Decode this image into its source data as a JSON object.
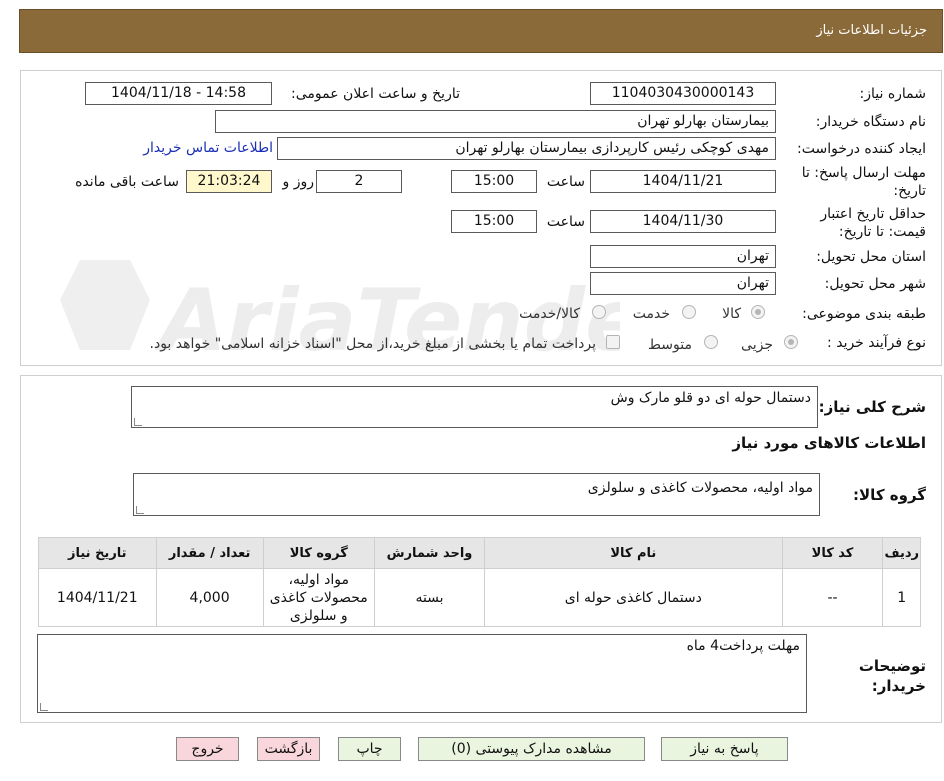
{
  "header": {
    "title": "جزئیات اطلاعات نیاز"
  },
  "form": {
    "need_number_label": "شماره نیاز:",
    "need_number": "1104030430000143",
    "announce_label": "تاریخ و ساعت اعلان عمومی:",
    "announce_value": "1404/11/18 - 14:58",
    "buyer_org_label": "نام دستگاه خریدار:",
    "buyer_org": "بیمارستان بهارلو تهران",
    "requester_label": "ایجاد کننده درخواست:",
    "requester": "مهدی کوچکی  رئیس کارپردازی بیمارستان بهارلو تهران",
    "contact_link": "اطلاعات تماس خریدار",
    "reply_deadline_label": "مهلت ارسال پاسخ: تا تاریخ:",
    "reply_date": "1404/11/21",
    "time_label": "ساعت",
    "reply_time": "15:00",
    "days_value": "2",
    "days_label": "روز و",
    "remaining_time": "21:03:24",
    "remaining_label": "ساعت باقی مانده",
    "validity_label": "حداقل تاریخ اعتبار قیمت: تا تاریخ:",
    "validity_date": "1404/11/30",
    "validity_time": "15:00",
    "province_label": "استان محل تحویل:",
    "province": "تهران",
    "city_label": "شهر محل تحویل:",
    "city": "تهران",
    "category_label": "طبقه بندی موضوعی:",
    "category_options": [
      "کالا",
      "خدمت",
      "کالا/خدمت"
    ],
    "process_label": "نوع فرآیند خرید :",
    "process_options": [
      "جزیی",
      "متوسط"
    ],
    "payment_note": "پرداخت تمام یا بخشی از مبلغ خرید،از محل \"اسناد خزانه اسلامی\" خواهد بود."
  },
  "details": {
    "summary_label": "شرح کلی نیاز:",
    "summary": "دستمال حوله ای دو قلو مارک وش",
    "goods_info_title": "اطلاعات کالاهای مورد نیاز",
    "goods_group_label": "گروه کالا:",
    "goods_group": "مواد اولیه، محصولات کاغذی و سلولزی",
    "table": {
      "headers": [
        "ردیف",
        "کد کالا",
        "نام کالا",
        "واحد شمارش",
        "گروه کالا",
        "تعداد / مقدار",
        "تاریخ نیاز"
      ],
      "rows": [
        [
          "1",
          "--",
          "دستمال کاغذی حوله ای",
          "بسته",
          "مواد اولیه، محصولات کاغذی و سلولزی",
          "4,000",
          "1404/11/21"
        ]
      ]
    },
    "buyer_notes_label": "توضیحات خریدار:",
    "buyer_notes": "مهلت پرداخت4 ماه"
  },
  "buttons": {
    "reply": "پاسخ به نیاز",
    "attachments": "مشاهده مدارک پیوستی (0)",
    "print": "چاپ",
    "back": "بازگشت",
    "exit": "خروج"
  },
  "watermark": {
    "text": "AriaTender.neT"
  },
  "colors": {
    "header_bg": "#8b6a3a",
    "button_green": "#e9f5df",
    "button_pink": "#f8d6dc",
    "link_blue": "#1a2fb5",
    "time_highlight": "#fff8cc"
  }
}
